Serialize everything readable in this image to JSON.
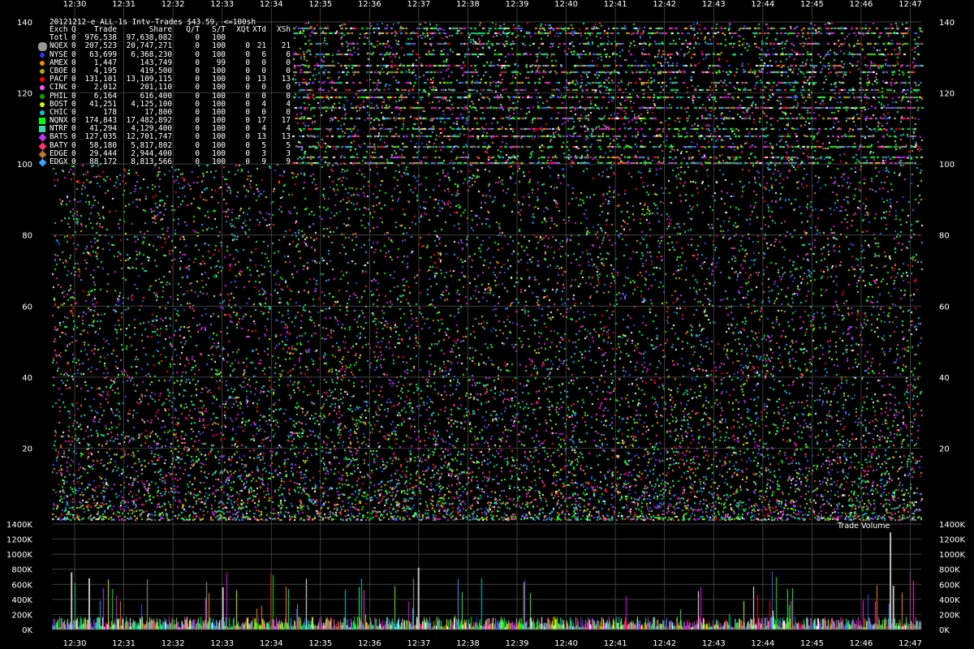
{
  "chart_data": [
    {
      "type": "scatter",
      "title": "20121212-e_ALL-1s Intv-Trades $43.59, <=100sh",
      "x_ticks": [
        "12:30",
        "12:31",
        "12:32",
        "12:33",
        "12:34",
        "12:35",
        "12:36",
        "12:37",
        "12:38",
        "12:39",
        "12:40",
        "12:41",
        "12:42",
        "12:43",
        "12:44",
        "12:45",
        "12:46",
        "12:47"
      ],
      "y_ticks": [
        20,
        40,
        60,
        80,
        100,
        120,
        140
      ],
      "ylim": [
        0,
        140
      ],
      "grid": true,
      "legend_placement": "top-left",
      "legend_headers": [
        "Exch",
        "Q",
        "Trade",
        "Share",
        "Q/T",
        "S/T",
        "XQt",
        "XTd",
        "XSh"
      ],
      "legend_rows": [
        {
          "exch": "Totl",
          "q": "0",
          "trade": "976,538",
          "share": "97,638,082",
          "qt": "0",
          "st": "100",
          "xqt": "",
          "xtd": "",
          "xsh": "",
          "color": "",
          "marker": "none"
        },
        {
          "exch": "NQEX",
          "q": "0",
          "trade": "207,523",
          "share": "20,747,271",
          "qt": "0",
          "st": "100",
          "xqt": "0",
          "xtd": "21",
          "xsh": "21",
          "color": "#999999",
          "marker": "hexagon"
        },
        {
          "exch": "NYSE",
          "q": "0",
          "trade": "63,699",
          "share": "6,368,230",
          "qt": "0",
          "st": "100",
          "xqt": "0",
          "xtd": "6",
          "xsh": "6",
          "color": "#3333ff",
          "marker": "circle"
        },
        {
          "exch": "AMEX",
          "q": "0",
          "trade": "1,447",
          "share": "143,749",
          "qt": "0",
          "st": "99",
          "xqt": "0",
          "xtd": "0",
          "xsh": "0",
          "color": "#ff8800",
          "marker": "circle"
        },
        {
          "exch": "CBOE",
          "q": "0",
          "trade": "4,195",
          "share": "419,500",
          "qt": "0",
          "st": "100",
          "xqt": "0",
          "xtd": "0",
          "xsh": "0",
          "color": "#aaaa00",
          "marker": "circle"
        },
        {
          "exch": "PACF",
          "q": "0",
          "trade": "131,101",
          "share": "13,109,115",
          "qt": "0",
          "st": "100",
          "xqt": "0",
          "xtd": "13",
          "xsh": "13",
          "color": "#ff0000",
          "marker": "circle"
        },
        {
          "exch": "CINC",
          "q": "0",
          "trade": "2,012",
          "share": "201,110",
          "qt": "0",
          "st": "100",
          "xqt": "0",
          "xtd": "0",
          "xsh": "0",
          "color": "#ff55ff",
          "marker": "circle"
        },
        {
          "exch": "PHIL",
          "q": "0",
          "trade": "6,164",
          "share": "616,400",
          "qt": "0",
          "st": "100",
          "xqt": "0",
          "xtd": "0",
          "xsh": "0",
          "color": "#00aa00",
          "marker": "circle"
        },
        {
          "exch": "BOST",
          "q": "0",
          "trade": "41,251",
          "share": "4,125,100",
          "qt": "0",
          "st": "100",
          "xqt": "0",
          "xtd": "4",
          "xsh": "4",
          "color": "#ccff00",
          "marker": "circle"
        },
        {
          "exch": "CHIC",
          "q": "0",
          "trade": "178",
          "share": "17,800",
          "qt": "0",
          "st": "100",
          "xqt": "0",
          "xtd": "0",
          "xsh": "0",
          "color": "#00cccc",
          "marker": "circle"
        },
        {
          "exch": "NQNX",
          "q": "0",
          "trade": "174,843",
          "share": "17,482,892",
          "qt": "0",
          "st": "100",
          "xqt": "0",
          "xtd": "17",
          "xsh": "17",
          "color": "#00ff00",
          "marker": "square"
        },
        {
          "exch": "NTRF",
          "q": "0",
          "trade": "41,294",
          "share": "4,129,400",
          "qt": "0",
          "st": "100",
          "xqt": "0",
          "xtd": "4",
          "xsh": "4",
          "color": "#33ddaa",
          "marker": "square"
        },
        {
          "exch": "BATS",
          "q": "0",
          "trade": "127,035",
          "share": "12,701,747",
          "qt": "0",
          "st": "100",
          "xqt": "0",
          "xtd": "13",
          "xsh": "13",
          "color": "#cc33ff",
          "marker": "diamond"
        },
        {
          "exch": "BATY",
          "q": "0",
          "trade": "58,180",
          "share": "5,817,802",
          "qt": "0",
          "st": "100",
          "xqt": "0",
          "xtd": "5",
          "xsh": "5",
          "color": "#ff3377",
          "marker": "diamond"
        },
        {
          "exch": "EDGE",
          "q": "0",
          "trade": "29,444",
          "share": "2,944,400",
          "qt": "0",
          "st": "100",
          "xqt": "0",
          "xtd": "3",
          "xsh": "3",
          "color": "#bb7733",
          "marker": "diamond"
        },
        {
          "exch": "EDGX",
          "q": "0",
          "trade": "88,172",
          "share": "8,813,566",
          "qt": "0",
          "st": "100",
          "xqt": "0",
          "xtd": "9",
          "xsh": "9",
          "color": "#33aaff",
          "marker": "diamond"
        }
      ]
    },
    {
      "type": "bar",
      "title": "Trade Volume",
      "x_ticks": [
        "12:30",
        "12:31",
        "12:32",
        "12:33",
        "12:34",
        "12:35",
        "12:36",
        "12:37",
        "12:38",
        "12:39",
        "12:40",
        "12:41",
        "12:42",
        "12:43",
        "12:44",
        "12:45",
        "12:46",
        "12:47"
      ],
      "y_ticks": [
        "0K",
        "200K",
        "400K",
        "600K",
        "800K",
        "1000K",
        "1200K",
        "1400K"
      ],
      "ylim": [
        0,
        1400
      ],
      "grid": true,
      "peaks": [
        {
          "time": "12:30",
          "value": 760
        },
        {
          "time": "12:30",
          "value": 680
        },
        {
          "time": "12:33",
          "value": 560
        },
        {
          "time": "12:37",
          "value": 820
        },
        {
          "time": "12:46",
          "value": 1290
        },
        {
          "time": "12:46",
          "value": 580
        }
      ]
    }
  ]
}
